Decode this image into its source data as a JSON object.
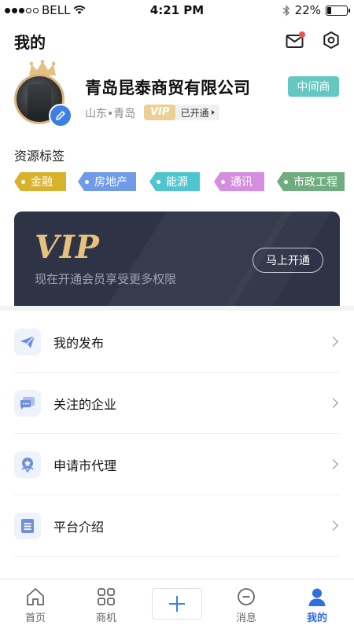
{
  "status_bar": {
    "carrier": "BELL",
    "time": "4:21 PM",
    "battery_text": "22%",
    "battery_level": 0.22
  },
  "header": {
    "title": "我的",
    "mail_has_unread": true
  },
  "profile": {
    "company_name": "青岛昆泰商贸有限公司",
    "role_badge": "中间商",
    "location": "山东•青岛",
    "vip_label": "VIP",
    "vip_status": "已开通"
  },
  "resource_tags": {
    "title": "资源标签",
    "items": [
      {
        "label": "金融",
        "color": "#d9b22c"
      },
      {
        "label": "房地产",
        "color": "#6f9be8"
      },
      {
        "label": "能源",
        "color": "#4fc6cf"
      },
      {
        "label": "通讯",
        "color": "#d58ee0"
      },
      {
        "label": "市政工程",
        "color": "#6fac7e"
      }
    ]
  },
  "vip_card": {
    "logo": "VIP",
    "subtitle": "现在开通会员享受更多权限",
    "button": "马上开通"
  },
  "menu": [
    {
      "label": "我的发布",
      "icon": "send-icon"
    },
    {
      "label": "关注的企业",
      "icon": "chat-icon"
    },
    {
      "label": "申请市代理",
      "icon": "agent-badge-icon"
    },
    {
      "label": "平台介绍",
      "icon": "document-icon"
    }
  ],
  "tabbar": {
    "items": [
      {
        "label": "首页",
        "icon": "home-icon"
      },
      {
        "label": "商机",
        "icon": "grid-icon"
      },
      {
        "label": "",
        "icon": "plus-icon"
      },
      {
        "label": "消息",
        "icon": "message-icon"
      },
      {
        "label": "我的",
        "icon": "profile-icon"
      }
    ],
    "active_index": 4
  },
  "colors": {
    "accent": "#2f6fe0",
    "vip_gold": "#e6c17e",
    "card_bg": "#2e3346",
    "role_badge": "#63c8c2"
  }
}
